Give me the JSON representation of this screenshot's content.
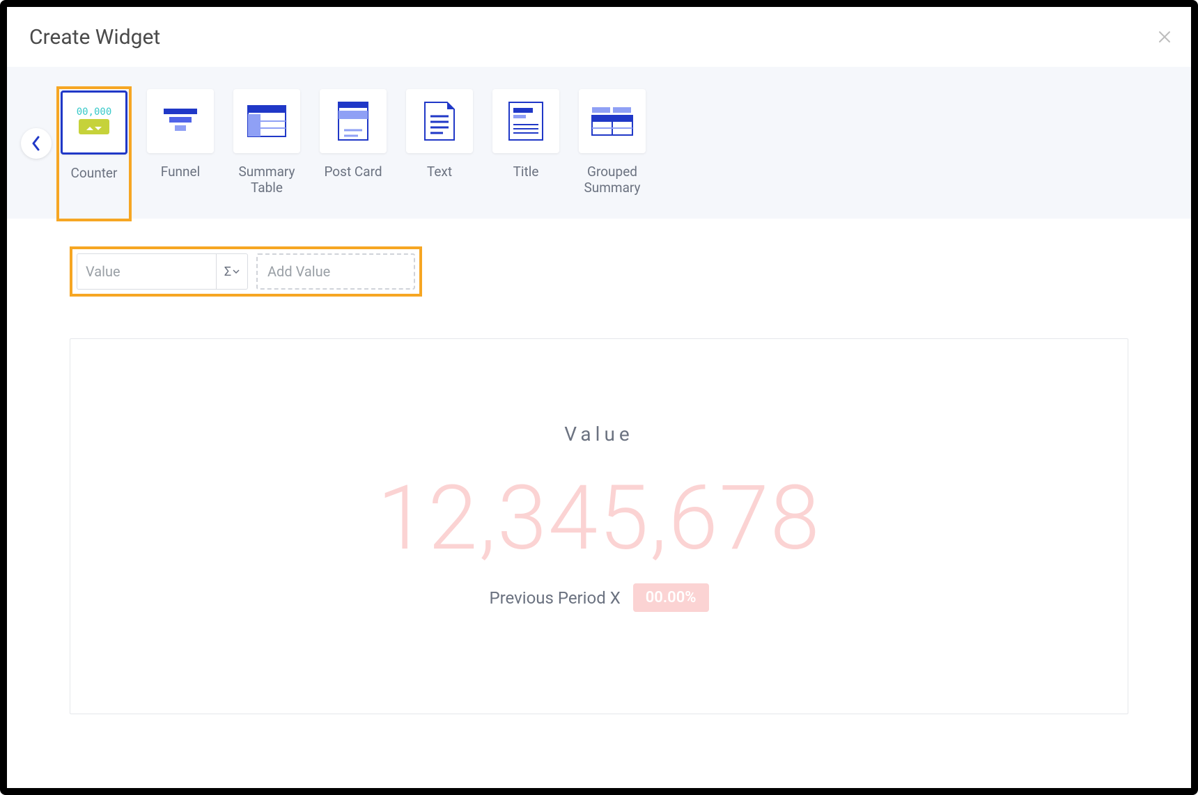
{
  "header": {
    "title": "Create Widget"
  },
  "widget_types": [
    {
      "id": "counter",
      "label": "Counter",
      "selected": true
    },
    {
      "id": "funnel",
      "label": "Funnel",
      "selected": false
    },
    {
      "id": "summary-table",
      "label": "Summary Table",
      "selected": false
    },
    {
      "id": "post-card",
      "label": "Post Card",
      "selected": false
    },
    {
      "id": "text",
      "label": "Text",
      "selected": false
    },
    {
      "id": "title",
      "label": "Title",
      "selected": false
    },
    {
      "id": "grouped-summary",
      "label": "Grouped Summary",
      "selected": false
    }
  ],
  "fields": {
    "value_placeholder": "Value",
    "aggregate_symbol": "Σ",
    "add_value_label": "Add Value"
  },
  "preview": {
    "label": "Value",
    "number": "12,345,678",
    "previous_label": "Previous Period X",
    "change_badge": "00.00%"
  },
  "highlights": {
    "selected_widget": "counter",
    "field_row": true
  },
  "icons": {
    "close": "close-icon",
    "chevron_left": "chevron-left-icon",
    "sigma": "sigma-icon",
    "caret_down": "caret-down-icon"
  }
}
